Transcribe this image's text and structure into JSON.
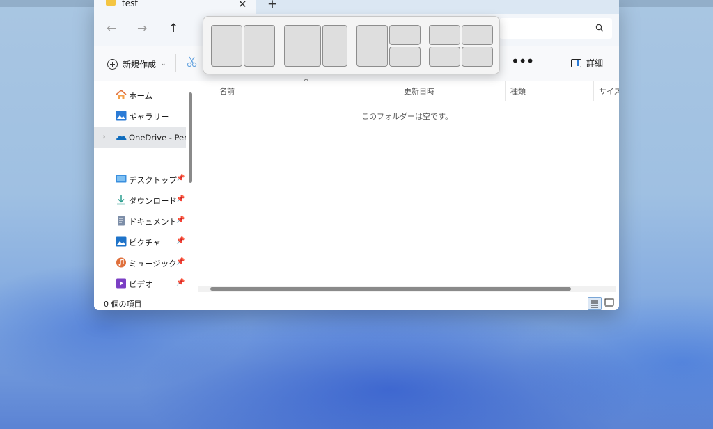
{
  "window": {
    "tab_title": "test",
    "tab_close_icon": "close-icon",
    "new_tab_icon": "plus-icon"
  },
  "nav": {
    "back_icon": "arrow-left-icon",
    "forward_icon": "arrow-right-icon",
    "up_icon": "arrow-up-icon",
    "search_icon": "search-icon"
  },
  "toolbar": {
    "new_label": "新規作成",
    "new_chevron": "⌄",
    "more_label": "•••",
    "details_label": "詳細"
  },
  "sidebar": {
    "items": [
      {
        "label": "ホーム",
        "icon": "home-icon"
      },
      {
        "label": "ギャラリー",
        "icon": "gallery-icon"
      },
      {
        "label": "OneDrive - Perso",
        "icon": "onedrive-icon",
        "selected": true,
        "expander": "›"
      }
    ],
    "pinned": [
      {
        "label": "デスクトップ",
        "icon": "desktop-icon"
      },
      {
        "label": "ダウンロード",
        "icon": "download-icon"
      },
      {
        "label": "ドキュメント",
        "icon": "document-icon"
      },
      {
        "label": "ピクチャ",
        "icon": "pictures-icon"
      },
      {
        "label": "ミュージック",
        "icon": "music-icon"
      },
      {
        "label": "ビデオ",
        "icon": "video-icon"
      }
    ],
    "pin_glyph": "📌"
  },
  "content": {
    "columns": [
      "名前",
      "更新日時",
      "種類",
      "サイズ"
    ],
    "sort_caret": "^",
    "empty_message": "このフォルダーは空です。"
  },
  "status": {
    "item_count": "0 個の項目"
  },
  "snap_layouts": {
    "layouts": [
      {
        "name": "two-equal-columns"
      },
      {
        "name": "wide-left-narrow-right"
      },
      {
        "name": "left-column-right-stacked"
      },
      {
        "name": "four-quadrants"
      }
    ]
  },
  "colors": {
    "accent": "#2b7bd6",
    "folder": "#f4c542",
    "selected_row": "#e5e7ea",
    "snap_cell": "#dedede"
  }
}
